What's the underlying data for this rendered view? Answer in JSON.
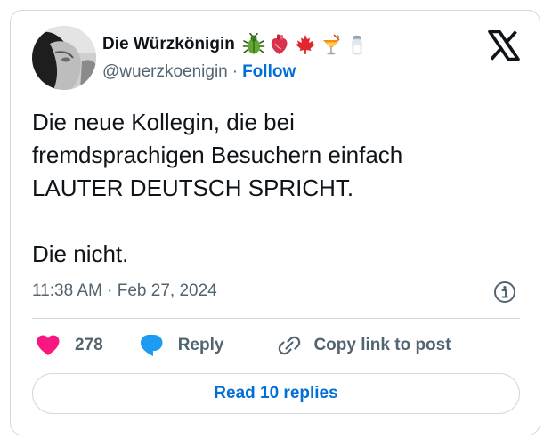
{
  "author": {
    "display_name": "Die Würzkönigin",
    "handle": "@wuerzkoenigin",
    "separator": "·",
    "follow_label": "Follow",
    "name_emojis": [
      "beetle-emoji",
      "anatomical-heart-emoji",
      "maple-leaf-emoji",
      "tropical-drink-emoji",
      "salt-shaker-emoji"
    ]
  },
  "tweet": {
    "text": "Die neue Kollegin, die bei\nfremdsprachigen Besuchern einfach\nLAUTER DEUTSCH SPRICHT.\n\nDie nicht.",
    "timestamp": "11:38 AM · Feb 27, 2024"
  },
  "actions": {
    "like_count": "278",
    "reply_label": "Reply",
    "copy_link_label": "Copy link to post"
  },
  "read_replies_label": "Read 10 replies",
  "colors": {
    "link_blue": "#006fd6",
    "like_pink": "#f91880",
    "reply_blue": "#1d9bf0",
    "text_primary": "#0f1419",
    "text_secondary": "#536471",
    "border": "#cfd9de"
  }
}
